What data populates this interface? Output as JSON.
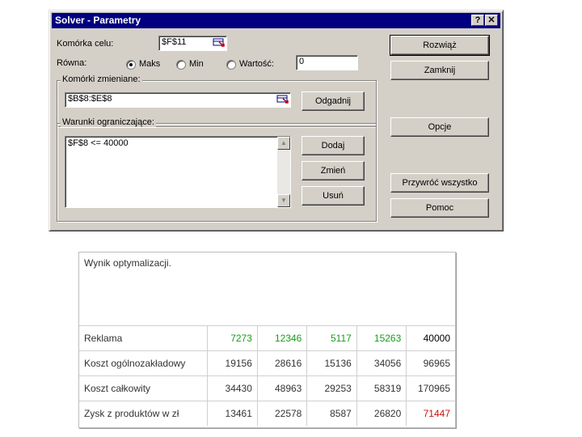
{
  "dialog": {
    "title": "Solver - Parametry",
    "help_label": "?",
    "close_label": "✕",
    "target_cell_label": "Komórka celu:",
    "target_cell_value": "$F$11",
    "equal_label": "Równa:",
    "radio_max": "Maks",
    "radio_min": "Min",
    "radio_value": "Wartość:",
    "value_field": "0",
    "changing_cells_label": "Komórki zmieniane:",
    "changing_cells_value": "$B$8:$E$8",
    "constraints_label": "Warunki ograniczające:",
    "constraints": [
      "$F$8 <= 40000"
    ],
    "buttons": {
      "solve": "Rozwiąż",
      "close": "Zamknij",
      "guess": "Odgadnij",
      "options": "Opcje",
      "add": "Dodaj",
      "change": "Zmień",
      "delete": "Usuń",
      "reset_all": "Przywróć wszystko",
      "help": "Pomoc"
    },
    "selected_radio": "max",
    "icons": [
      "help-icon",
      "close-icon",
      "ref-edit-icon",
      "scroll-up-icon",
      "scroll-down-icon"
    ]
  },
  "result": {
    "title": "Wynik optymalizacji.",
    "rows": [
      {
        "label": "Reklama",
        "values": [
          "7273",
          "12346",
          "5117",
          "15263",
          "40000"
        ],
        "value_colors": [
          "#1a9a1a",
          "#1a9a1a",
          "#1a9a1a",
          "#1a9a1a",
          "#000000"
        ]
      },
      {
        "label": "Koszt ogólnozakładowy",
        "values": [
          "19156",
          "28616",
          "15136",
          "34056",
          "96965"
        ]
      },
      {
        "label": "Koszt całkowity",
        "values": [
          "34430",
          "48963",
          "29253",
          "58319",
          "170965"
        ]
      },
      {
        "label": "Zysk z produktów w zł",
        "values": [
          "13461",
          "22578",
          "8587",
          "26820",
          "71447"
        ],
        "value_colors": [
          null,
          null,
          null,
          null,
          "#cc1111"
        ]
      }
    ]
  }
}
